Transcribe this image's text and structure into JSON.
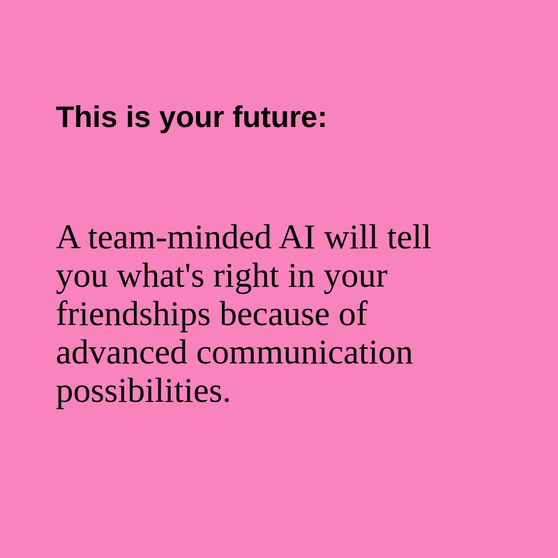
{
  "colors": {
    "background": "#F984BD",
    "text": "#000000"
  },
  "card": {
    "heading": "This is your future:",
    "body": "A team-minded AI will tell\nyou what's right in your\nfriendships because of\nadvanced communication\npossibilities."
  }
}
